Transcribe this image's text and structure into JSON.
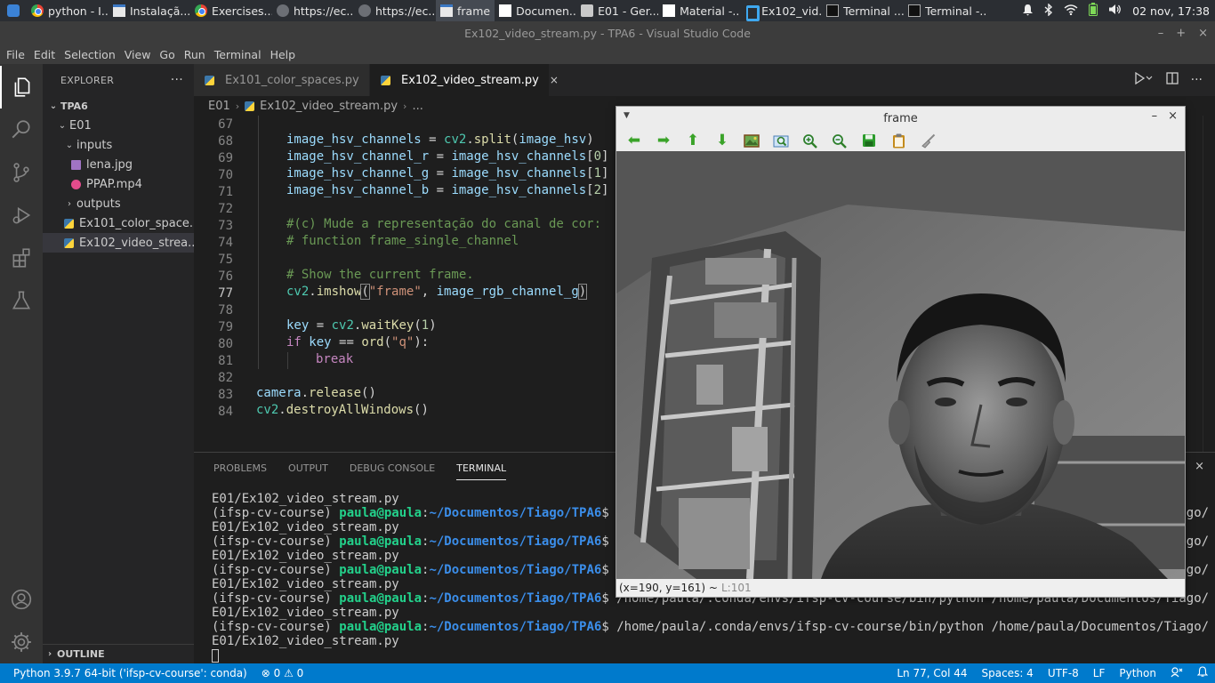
{
  "taskbar": {
    "apps": [
      {
        "label": "python - I...",
        "icon": "chrome-icon"
      },
      {
        "label": "Instalaçã...",
        "icon": "window-icon"
      },
      {
        "label": "Exercises...",
        "icon": "chrome-icon"
      },
      {
        "label": "https://ec...",
        "icon": "browser-icon"
      },
      {
        "label": "https://ec...",
        "icon": "browser-icon"
      },
      {
        "label": "frame",
        "icon": "window-icon"
      },
      {
        "label": "Documen...",
        "icon": "document-icon"
      },
      {
        "label": "E01 - Ger...",
        "icon": "folder-icon"
      },
      {
        "label": "Material -...",
        "icon": "document-icon"
      },
      {
        "label": "Ex102_vid...",
        "icon": "vscode-icon"
      },
      {
        "label": "Terminal ...",
        "icon": "terminal-icon"
      },
      {
        "label": "Terminal -...",
        "icon": "terminal-icon"
      }
    ],
    "clock": "02 nov, 17:38"
  },
  "window": {
    "title": "Ex102_video_stream.py - TPA6 - Visual Studio Code",
    "controls": {
      "minimize": "–",
      "maximize": "+",
      "close": "×"
    }
  },
  "menu": [
    "File",
    "Edit",
    "Selection",
    "View",
    "Go",
    "Run",
    "Terminal",
    "Help"
  ],
  "explorer": {
    "title": "EXPLORER",
    "more": "···",
    "root": "TPA6",
    "folder": "E01",
    "items": [
      {
        "label": "inputs",
        "kind": "folder-open"
      },
      {
        "label": "lena.jpg",
        "kind": "image"
      },
      {
        "label": "PPAP.mp4",
        "kind": "video"
      },
      {
        "label": "outputs",
        "kind": "folder-closed"
      },
      {
        "label": "Ex101_color_space...",
        "kind": "python"
      },
      {
        "label": "Ex102_video_strea...",
        "kind": "python"
      }
    ],
    "outline": "OUTLINE"
  },
  "tabs": [
    {
      "label": "Ex101_color_spaces.py",
      "active": false
    },
    {
      "label": "Ex102_video_stream.py",
      "active": true
    }
  ],
  "tab_close": "×",
  "breadcrumb": {
    "folder": "E01",
    "file": "Ex102_video_stream.py",
    "rest": "..."
  },
  "code": {
    "lines": [
      {
        "n": "67"
      },
      {
        "n": "68"
      },
      {
        "n": "69"
      },
      {
        "n": "70"
      },
      {
        "n": "71"
      },
      {
        "n": "72"
      },
      {
        "n": "73"
      },
      {
        "n": "74"
      },
      {
        "n": "75"
      },
      {
        "n": "76"
      },
      {
        "n": "77"
      },
      {
        "n": "78"
      },
      {
        "n": "79"
      },
      {
        "n": "80"
      },
      {
        "n": "81"
      },
      {
        "n": "82"
      },
      {
        "n": "83"
      },
      {
        "n": "84"
      }
    ],
    "l68": {
      "var": "image_hsv_channels",
      "eq": " = ",
      "mod": "cv2",
      "dot": ".",
      "fn": "split",
      "open": "(",
      "arg": "image_hsv",
      "close": ")"
    },
    "l69": {
      "var": "image_hsv_channel_r",
      "eq": " = ",
      "arr": "image_hsv_channels",
      "open": "[",
      "idx": "0",
      "close": "]"
    },
    "l70": {
      "var": "image_hsv_channel_g",
      "eq": " = ",
      "arr": "image_hsv_channels",
      "open": "[",
      "idx": "1",
      "close": "]"
    },
    "l71": {
      "var": "image_hsv_channel_b",
      "eq": " = ",
      "arr": "image_hsv_channels",
      "open": "[",
      "idx": "2",
      "close": "]"
    },
    "l73": "#(c) Mude a representação do canal de cor:",
    "l74": "# function frame_single_channel",
    "l76": "# Show the current frame.",
    "l77": {
      "mod": "cv2",
      "dot": ".",
      "fn": "imshow",
      "open": "(",
      "str": "\"frame\"",
      "comma": ", ",
      "arg": "image_rgb_channel_g",
      "close": ")"
    },
    "l79": {
      "var": "key",
      "eq": " = ",
      "mod": "cv2",
      "dot": ".",
      "fn": "waitKey",
      "open": "(",
      "num": "1",
      "close": ")"
    },
    "l80": {
      "kw": "if",
      "sp": " ",
      "var": "key",
      "eq": " == ",
      "fn": "ord",
      "open": "(",
      "str": "\"q\"",
      "close": "):"
    },
    "l81": "break",
    "l83": {
      "var": "camera",
      "dot": ".",
      "fn": "release",
      "paren": "()"
    },
    "l84": {
      "mod": "cv2",
      "dot": ".",
      "fn": "destroyAllWindows",
      "paren": "()"
    }
  },
  "panel": {
    "tabs": [
      "PROBLEMS",
      "OUTPUT",
      "DEBUG CONSOLE",
      "TERMINAL"
    ],
    "close": "×",
    "terminal": {
      "first_line": "E01/Ex102_video_stream.py",
      "env": "(ifsp-cv-course) ",
      "user": "paula@paula",
      "colon": ":",
      "path": "~/Documentos/Tiago/TPA6",
      "dollar": "$ ",
      "cmd": "/home/paula/.conda/envs/ifsp-cv-course/bin/python /home/paula/Documentos/Tiago/TPA6/",
      "file_line": "E01/Ex102_video_stream.py",
      "repeat": 5
    }
  },
  "statusbar": {
    "interpreter": "Python 3.9.7 64-bit ('ifsp-cv-course': conda)",
    "problems": "⊗ 0 ⚠ 0",
    "position": "Ln 77, Col 44",
    "spaces": "Spaces: 4",
    "encoding": "UTF-8",
    "eol": "LF",
    "language": "Python"
  },
  "frame_window": {
    "title": "frame",
    "controls": {
      "minimize": "–",
      "close": "×"
    },
    "status_coords": "(x=190, y=161) ~",
    "status_level": "L:101"
  }
}
